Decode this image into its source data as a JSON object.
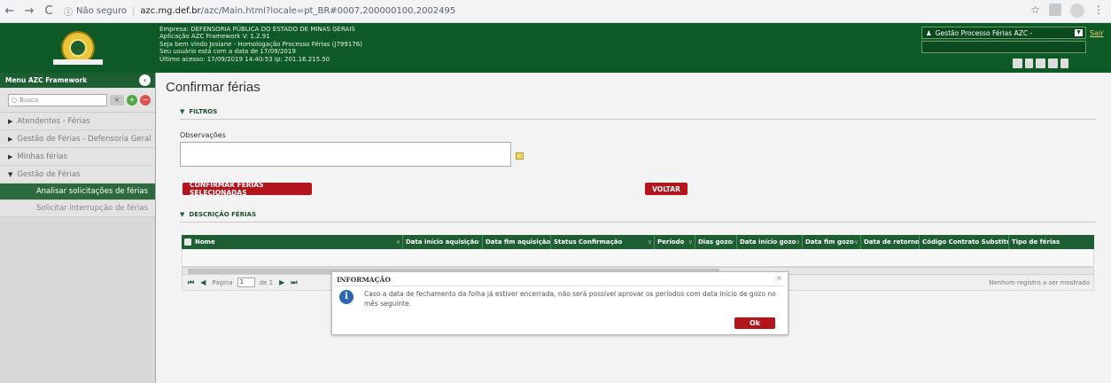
{
  "browser": {
    "not_secure": "Não seguro",
    "host": "azc.mg.def.br",
    "path": "/azc/Main.html?locale=pt_BR#0007,200000100,2002495"
  },
  "header": {
    "lines": [
      "Empresa: DEFENSORIA PÚBLICA DO ESTADO DE MINAS GERAIS",
      "Aplicação AZC Framework V: 1.2.91",
      "Seja bem vindo Josiane - Homologação Processo Férias (J799176)",
      "Seu usuário está com a data de 17/09/2019",
      "Último acesso: 17/09/2019 14:40:53 Ip: 201.16.215.50"
    ],
    "app_select": "Gestão Processo Férias AZC -",
    "sair": "Sair"
  },
  "sidebar": {
    "title": "Menu AZC Framework",
    "search_placeholder": "Busca",
    "items": [
      {
        "label": "Atendentes - Férias"
      },
      {
        "label": "Gestão de Férias - Defensoria Geral"
      },
      {
        "label": "Minhas férias"
      },
      {
        "label": "Gestão de Férias"
      }
    ],
    "subitems": [
      {
        "label": "Analisar solicitações de férias",
        "active": true
      },
      {
        "label": "Solicitar interrupção de férias",
        "active": false
      }
    ]
  },
  "main": {
    "title": "Confirmar férias",
    "filters_label": "FILTROS",
    "obs_label": "Observações",
    "confirm_button": "CONFIRMAR FÉRIAS SELECIONADAS",
    "back_button": "VOLTAR",
    "description_label": "DESCRIÇÃO FÉRIAS",
    "columns": [
      "Nome",
      "Data início aquisição",
      "Data fim aquisição",
      "Status Confirmação",
      "Período",
      "Dias gozo",
      "Data início gozo",
      "Data fim gozo",
      "Data de retorno",
      "Código Contrato Substituto",
      "Tipo de férias"
    ],
    "pager": {
      "page_label": "Página",
      "page_value": "1",
      "of_label": "de 1",
      "empty_message": "Nenhum registro a ser mostrado"
    }
  },
  "modal": {
    "title": "INFORMAÇÃO",
    "message": "Caso a data de fechamento da folha já estiver encerrada, não será possível aprovar os períodos com data início de gozo no mês seguinte.",
    "ok": "Ok"
  }
}
